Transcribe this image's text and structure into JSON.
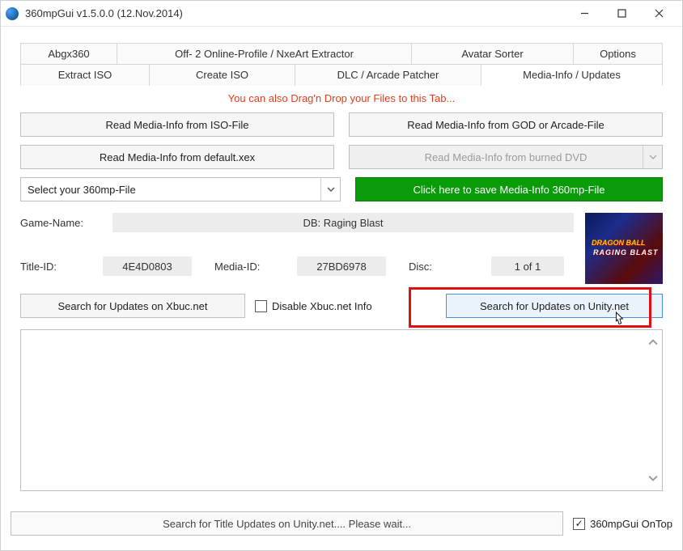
{
  "window": {
    "title": "360mpGui v1.5.0.0 (12.Nov.2014)"
  },
  "tabs_row1": [
    "Abgx360",
    "Off- 2 Online-Profile / NxeArt Extractor",
    "Avatar Sorter",
    "Options"
  ],
  "tabs_row2": [
    "Extract ISO",
    "Create ISO",
    "DLC / Arcade Patcher",
    "Media-Info / Updates"
  ],
  "hint": "You can also Drag'n Drop your Files to this Tab...",
  "buttons": {
    "read_iso": "Read Media-Info from ISO-File",
    "read_god": "Read Media-Info from GOD or Arcade-File",
    "read_xex": "Read Media-Info from default.xex",
    "read_dvd": "Read Media-Info from burned DVD",
    "save_green": "Click here to save Media-Info 360mp-File",
    "select_file": "Select your 360mp-File",
    "search_xbuc": "Search for Updates on Xbuc.net",
    "disable_xbuc": "Disable Xbuc.net Info",
    "search_unity": "Search for Updates on Unity.net"
  },
  "labels": {
    "game_name": "Game-Name:",
    "title_id": "Title-ID:",
    "media_id": "Media-ID:",
    "disc": "Disc:"
  },
  "values": {
    "game_name": "DB: Raging Blast",
    "title_id": "4E4D0803",
    "media_id": "27BD6978",
    "disc": "1 of 1"
  },
  "cover": {
    "line1": "DRAGON BALL",
    "line2": "RAGING BLAST"
  },
  "status": "Search for Title Updates on Unity.net.... Please wait...",
  "ontop": {
    "label": "360mpGui OnTop",
    "checked": true
  }
}
